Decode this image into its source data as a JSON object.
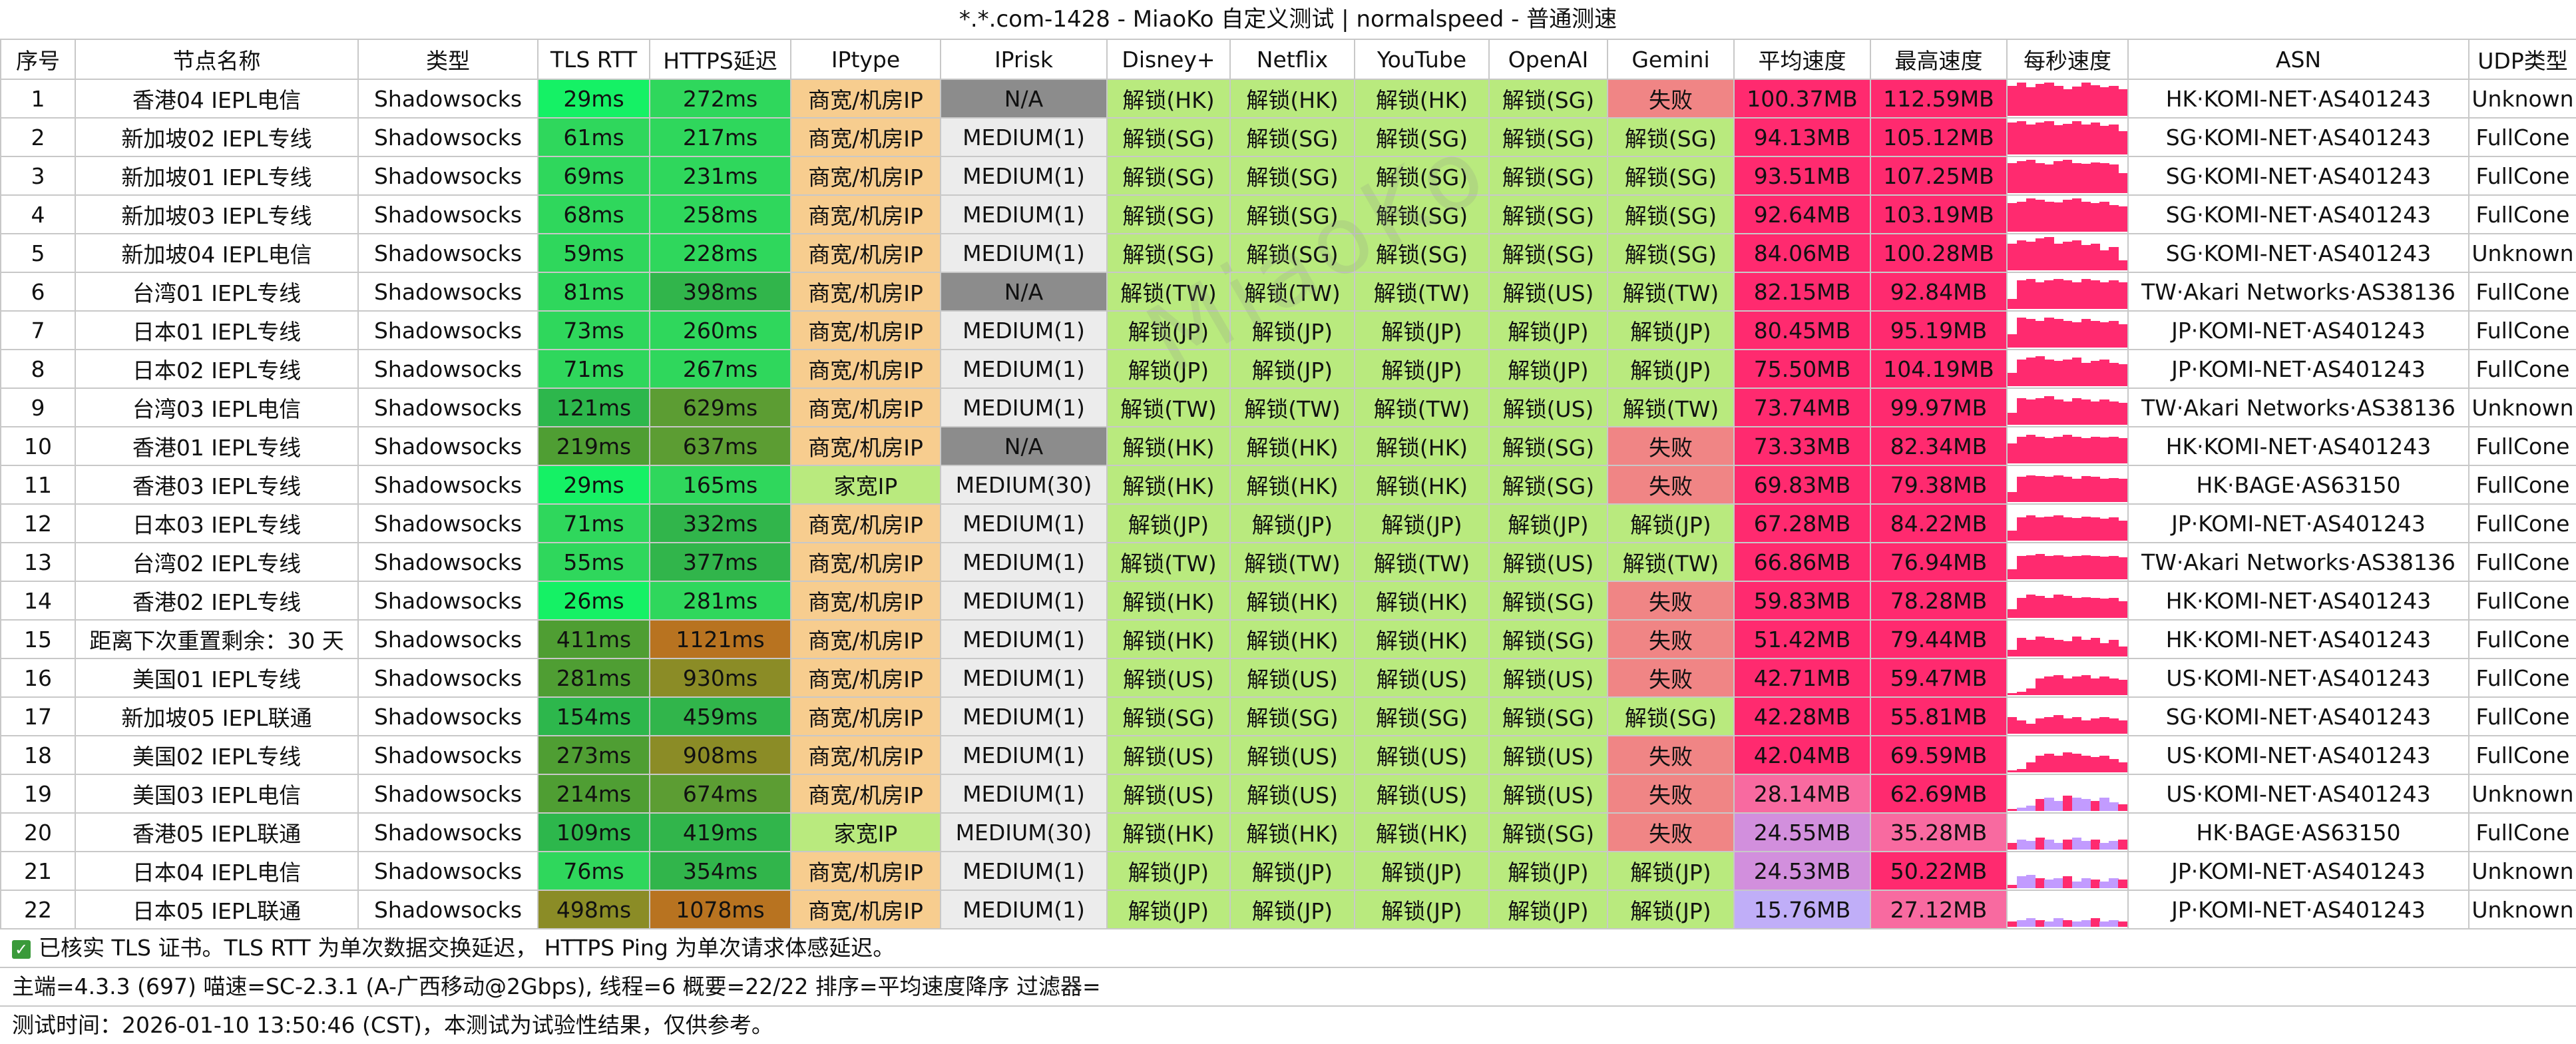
{
  "title": "*.*.com-1428 - MiaoKo 自定义测试 | normalspeed - 普通测速",
  "watermark": "MiaoKo",
  "columns": [
    "序号",
    "节点名称",
    "类型",
    "TLS RTT",
    "HTTPS延迟",
    "IPtype",
    "IPrisk",
    "Disney+",
    "Netflix",
    "YouTube",
    "OpenAI",
    "Gemini",
    "平均速度",
    "最高速度",
    "每秒速度",
    "ASN",
    "UDP类型"
  ],
  "colors": {
    "n_a": "#8c8c8c",
    "medium_bg": "#ececec",
    "unlock_bg": "#b9ea7e",
    "fail_bg": "#f08585",
    "iptype_bg": "#f7cd8f",
    "spark_pink": "#ff2a6f",
    "spark_violet": "#c29bff",
    "tls_fast": "#15f165",
    "tls_mid": "#2fd75c",
    "tls_slow": "#2db74c",
    "tls_slower": "#4f9e33",
    "tls_worst": "#8b8c26",
    "https_fast": "#2fd75c",
    "https_mid": "#31b54b",
    "https_slow": "#5c9d33",
    "https_slower": "#8b8c26",
    "https_worst": "#b87320",
    "speed_hi": "#ff2a6f",
    "speed_mid": "#f86aa0",
    "speed_low": "#d28fdd",
    "speed_lowest": "#c0aef8"
  },
  "rows": [
    {
      "idx": "1",
      "name": "香港04 IEPL电信",
      "type": "Shadowsocks",
      "tls": "29ms",
      "tls_c": "#15f165",
      "https": "272ms",
      "https_c": "#2fd75c",
      "iptype": "商宽/机房IP",
      "iptype_c": "#f7cd8f",
      "iprisk": "N/A",
      "iprisk_c": "#8c8c8c",
      "disney": "解锁(HK)",
      "netflix": "解锁(HK)",
      "youtube": "解锁(HK)",
      "openai": "解锁(SG)",
      "gemini": "失败",
      "gemini_c": "#f08585",
      "avg": "100.37MB",
      "avg_c": "#ff2a6f",
      "max": "112.59MB",
      "max_c": "#ff2a6f",
      "spark": [
        0.9,
        1,
        0.85,
        0.95,
        1,
        0.9,
        0.8,
        0.88,
        1,
        0.92,
        0.85,
        0.9,
        0.8
      ],
      "asn": "HK·KOMI-NET·AS401243",
      "udp": "Unknown"
    },
    {
      "idx": "2",
      "name": "新加坡02 IEPL专线",
      "type": "Shadowsocks",
      "tls": "61ms",
      "tls_c": "#2fd75c",
      "https": "217ms",
      "https_c": "#2fd75c",
      "iptype": "商宽/机房IP",
      "iptype_c": "#f7cd8f",
      "iprisk": "MEDIUM(1)",
      "iprisk_c": "#ececec",
      "disney": "解锁(SG)",
      "netflix": "解锁(SG)",
      "youtube": "解锁(SG)",
      "openai": "解锁(SG)",
      "gemini": "解锁(SG)",
      "gemini_c": "#b9ea7e",
      "avg": "94.13MB",
      "avg_c": "#ff2a6f",
      "max": "105.12MB",
      "max_c": "#ff2a6f",
      "spark": [
        0.95,
        1,
        0.9,
        0.95,
        1,
        0.88,
        0.92,
        1,
        0.9,
        0.95,
        0.85,
        0.9,
        0.7
      ],
      "asn": "SG·KOMI-NET·AS401243",
      "udp": "FullCone"
    },
    {
      "idx": "3",
      "name": "新加坡01 IEPL专线",
      "type": "Shadowsocks",
      "tls": "69ms",
      "tls_c": "#2fd75c",
      "https": "231ms",
      "https_c": "#2fd75c",
      "iptype": "商宽/机房IP",
      "iptype_c": "#f7cd8f",
      "iprisk": "MEDIUM(1)",
      "iprisk_c": "#ececec",
      "disney": "解锁(SG)",
      "netflix": "解锁(SG)",
      "youtube": "解锁(SG)",
      "openai": "解锁(SG)",
      "gemini": "解锁(SG)",
      "gemini_c": "#b9ea7e",
      "avg": "93.51MB",
      "avg_c": "#ff2a6f",
      "max": "107.25MB",
      "max_c": "#ff2a6f",
      "spark": [
        0.9,
        0.95,
        1,
        0.9,
        0.85,
        0.95,
        1,
        0.9,
        0.88,
        0.92,
        0.9,
        0.85,
        0.6
      ],
      "asn": "SG·KOMI-NET·AS401243",
      "udp": "FullCone"
    },
    {
      "idx": "4",
      "name": "新加坡03 IEPL专线",
      "type": "Shadowsocks",
      "tls": "68ms",
      "tls_c": "#2fd75c",
      "https": "258ms",
      "https_c": "#2fd75c",
      "iptype": "商宽/机房IP",
      "iptype_c": "#f7cd8f",
      "iprisk": "MEDIUM(1)",
      "iprisk_c": "#ececec",
      "disney": "解锁(SG)",
      "netflix": "解锁(SG)",
      "youtube": "解锁(SG)",
      "openai": "解锁(SG)",
      "gemini": "解锁(SG)",
      "gemini_c": "#b9ea7e",
      "avg": "92.64MB",
      "avg_c": "#ff2a6f",
      "max": "103.19MB",
      "max_c": "#ff2a6f",
      "spark": [
        0.85,
        0.9,
        1,
        0.95,
        0.9,
        0.88,
        0.95,
        1,
        0.9,
        0.85,
        0.9,
        0.8,
        0.75
      ],
      "asn": "SG·KOMI-NET·AS401243",
      "udp": "FullCone"
    },
    {
      "idx": "5",
      "name": "新加坡04 IEPL电信",
      "type": "Shadowsocks",
      "tls": "59ms",
      "tls_c": "#2fd75c",
      "https": "228ms",
      "https_c": "#2fd75c",
      "iptype": "商宽/机房IP",
      "iptype_c": "#f7cd8f",
      "iprisk": "MEDIUM(1)",
      "iprisk_c": "#ececec",
      "disney": "解锁(SG)",
      "netflix": "解锁(SG)",
      "youtube": "解锁(SG)",
      "openai": "解锁(SG)",
      "gemini": "解锁(SG)",
      "gemini_c": "#b9ea7e",
      "avg": "84.06MB",
      "avg_c": "#ff2a6f",
      "max": "100.28MB",
      "max_c": "#ff2a6f",
      "spark": [
        0.8,
        0.9,
        0.85,
        0.95,
        1,
        0.8,
        0.85,
        0.9,
        0.75,
        0.8,
        0.6,
        0.7,
        0.3
      ],
      "asn": "SG·KOMI-NET·AS401243",
      "udp": "Unknown"
    },
    {
      "idx": "6",
      "name": "台湾01 IEPL专线",
      "type": "Shadowsocks",
      "tls": "81ms",
      "tls_c": "#2fd75c",
      "https": "398ms",
      "https_c": "#31b54b",
      "iptype": "商宽/机房IP",
      "iptype_c": "#f7cd8f",
      "iprisk": "N/A",
      "iprisk_c": "#8c8c8c",
      "disney": "解锁(TW)",
      "netflix": "解锁(TW)",
      "youtube": "解锁(TW)",
      "openai": "解锁(US)",
      "gemini": "解锁(TW)",
      "gemini_c": "#b9ea7e",
      "avg": "82.15MB",
      "avg_c": "#ff2a6f",
      "max": "92.84MB",
      "max_c": "#ff2a6f",
      "spark": [
        0.3,
        0.85,
        0.9,
        0.8,
        0.85,
        0.9,
        0.85,
        0.8,
        0.9,
        0.85,
        0.8,
        0.85,
        0.8
      ],
      "asn": "TW·Akari Networks·AS38136",
      "udp": "FullCone"
    },
    {
      "idx": "7",
      "name": "日本01 IEPL专线",
      "type": "Shadowsocks",
      "tls": "73ms",
      "tls_c": "#2fd75c",
      "https": "260ms",
      "https_c": "#2fd75c",
      "iptype": "商宽/机房IP",
      "iptype_c": "#f7cd8f",
      "iprisk": "MEDIUM(1)",
      "iprisk_c": "#ececec",
      "disney": "解锁(JP)",
      "netflix": "解锁(JP)",
      "youtube": "解锁(JP)",
      "openai": "解锁(JP)",
      "gemini": "解锁(JP)",
      "gemini_c": "#b9ea7e",
      "avg": "80.45MB",
      "avg_c": "#ff2a6f",
      "max": "95.19MB",
      "max_c": "#ff2a6f",
      "spark": [
        0.4,
        0.9,
        0.85,
        0.8,
        0.9,
        0.85,
        0.8,
        0.75,
        0.85,
        0.8,
        0.75,
        0.8,
        0.7
      ],
      "asn": "JP·KOMI-NET·AS401243",
      "udp": "FullCone"
    },
    {
      "idx": "8",
      "name": "日本02 IEPL专线",
      "type": "Shadowsocks",
      "tls": "71ms",
      "tls_c": "#2fd75c",
      "https": "267ms",
      "https_c": "#2fd75c",
      "iptype": "商宽/机房IP",
      "iptype_c": "#f7cd8f",
      "iprisk": "MEDIUM(1)",
      "iprisk_c": "#ececec",
      "disney": "解锁(JP)",
      "netflix": "解锁(JP)",
      "youtube": "解锁(JP)",
      "openai": "解锁(JP)",
      "gemini": "解锁(JP)",
      "gemini_c": "#b9ea7e",
      "avg": "75.50MB",
      "avg_c": "#ff2a6f",
      "max": "104.19MB",
      "max_c": "#ff2a6f",
      "spark": [
        0.4,
        0.8,
        0.85,
        0.9,
        0.8,
        0.75,
        0.8,
        0.85,
        0.7,
        0.75,
        0.8,
        0.7,
        0.65
      ],
      "asn": "JP·KOMI-NET·AS401243",
      "udp": "FullCone"
    },
    {
      "idx": "9",
      "name": "台湾03 IEPL电信",
      "type": "Shadowsocks",
      "tls": "121ms",
      "tls_c": "#2db74c",
      "https": "629ms",
      "https_c": "#5c9d33",
      "iptype": "商宽/机房IP",
      "iptype_c": "#f7cd8f",
      "iprisk": "MEDIUM(1)",
      "iprisk_c": "#ececec",
      "disney": "解锁(TW)",
      "netflix": "解锁(TW)",
      "youtube": "解锁(TW)",
      "openai": "解锁(US)",
      "gemini": "解锁(TW)",
      "gemini_c": "#b9ea7e",
      "avg": "73.74MB",
      "avg_c": "#ff2a6f",
      "max": "99.97MB",
      "max_c": "#ff2a6f",
      "spark": [
        0.35,
        0.8,
        0.75,
        0.8,
        0.85,
        0.75,
        0.7,
        0.8,
        0.75,
        0.7,
        0.75,
        0.7,
        0.65
      ],
      "asn": "TW·Akari Networks·AS38136",
      "udp": "Unknown"
    },
    {
      "idx": "10",
      "name": "香港01 IEPL专线",
      "type": "Shadowsocks",
      "tls": "219ms",
      "tls_c": "#4f9e33",
      "https": "637ms",
      "https_c": "#5c9d33",
      "iptype": "商宽/机房IP",
      "iptype_c": "#f7cd8f",
      "iprisk": "N/A",
      "iprisk_c": "#8c8c8c",
      "disney": "解锁(HK)",
      "netflix": "解锁(HK)",
      "youtube": "解锁(HK)",
      "openai": "解锁(SG)",
      "gemini": "失败",
      "gemini_c": "#f08585",
      "avg": "73.33MB",
      "avg_c": "#ff2a6f",
      "max": "82.34MB",
      "max_c": "#ff2a6f",
      "spark": [
        0.6,
        0.8,
        0.85,
        0.8,
        0.75,
        0.8,
        0.85,
        0.8,
        0.75,
        0.8,
        0.78,
        0.8,
        0.75
      ],
      "asn": "HK·KOMI-NET·AS401243",
      "udp": "FullCone"
    },
    {
      "idx": "11",
      "name": "香港03 IEPL专线",
      "type": "Shadowsocks",
      "tls": "29ms",
      "tls_c": "#15f165",
      "https": "165ms",
      "https_c": "#2fd75c",
      "iptype": "家宽IP",
      "iptype_c": "#b9ea7e",
      "iprisk": "MEDIUM(30)",
      "iprisk_c": "#ececec",
      "disney": "解锁(HK)",
      "netflix": "解锁(HK)",
      "youtube": "解锁(HK)",
      "openai": "解锁(SG)",
      "gemini": "失败",
      "gemini_c": "#f08585",
      "avg": "69.83MB",
      "avg_c": "#ff2a6f",
      "max": "79.38MB",
      "max_c": "#ff2a6f",
      "spark": [
        0.3,
        0.75,
        0.8,
        0.78,
        0.75,
        0.8,
        0.75,
        0.7,
        0.78,
        0.75,
        0.7,
        0.72,
        0.7
      ],
      "asn": "HK·BAGE·AS63150",
      "udp": "FullCone"
    },
    {
      "idx": "12",
      "name": "日本03 IEPL专线",
      "type": "Shadowsocks",
      "tls": "71ms",
      "tls_c": "#2fd75c",
      "https": "332ms",
      "https_c": "#31b54b",
      "iptype": "商宽/机房IP",
      "iptype_c": "#f7cd8f",
      "iprisk": "MEDIUM(1)",
      "iprisk_c": "#ececec",
      "disney": "解锁(JP)",
      "netflix": "解锁(JP)",
      "youtube": "解锁(JP)",
      "openai": "解锁(JP)",
      "gemini": "解锁(JP)",
      "gemini_c": "#b9ea7e",
      "avg": "67.28MB",
      "avg_c": "#ff2a6f",
      "max": "84.22MB",
      "max_c": "#ff2a6f",
      "spark": [
        0.3,
        0.7,
        0.75,
        0.7,
        0.72,
        0.75,
        0.7,
        0.68,
        0.72,
        0.7,
        0.65,
        0.7,
        0.6
      ],
      "asn": "JP·KOMI-NET·AS401243",
      "udp": "FullCone"
    },
    {
      "idx": "13",
      "name": "台湾02 IEPL专线",
      "type": "Shadowsocks",
      "tls": "55ms",
      "tls_c": "#2fd75c",
      "https": "377ms",
      "https_c": "#31b54b",
      "iptype": "商宽/机房IP",
      "iptype_c": "#f7cd8f",
      "iprisk": "MEDIUM(1)",
      "iprisk_c": "#ececec",
      "disney": "解锁(TW)",
      "netflix": "解锁(TW)",
      "youtube": "解锁(TW)",
      "openai": "解锁(US)",
      "gemini": "解锁(TW)",
      "gemini_c": "#b9ea7e",
      "avg": "66.86MB",
      "avg_c": "#ff2a6f",
      "max": "76.94MB",
      "max_c": "#ff2a6f",
      "spark": [
        0.3,
        0.7,
        0.72,
        0.75,
        0.7,
        0.72,
        0.68,
        0.7,
        0.72,
        0.7,
        0.68,
        0.7,
        0.65
      ],
      "asn": "TW·Akari Networks·AS38136",
      "udp": "FullCone"
    },
    {
      "idx": "14",
      "name": "香港02 IEPL专线",
      "type": "Shadowsocks",
      "tls": "26ms",
      "tls_c": "#15f165",
      "https": "281ms",
      "https_c": "#2fd75c",
      "iptype": "商宽/机房IP",
      "iptype_c": "#f7cd8f",
      "iprisk": "MEDIUM(1)",
      "iprisk_c": "#ececec",
      "disney": "解锁(HK)",
      "netflix": "解锁(HK)",
      "youtube": "解锁(HK)",
      "openai": "解锁(SG)",
      "gemini": "失败",
      "gemini_c": "#f08585",
      "avg": "59.83MB",
      "avg_c": "#ff2a6f",
      "max": "78.28MB",
      "max_c": "#ff2a6f",
      "spark": [
        0.25,
        0.6,
        0.7,
        0.65,
        0.6,
        0.7,
        0.65,
        0.6,
        0.62,
        0.6,
        0.58,
        0.6,
        0.5
      ],
      "asn": "HK·KOMI-NET·AS401243",
      "udp": "FullCone"
    },
    {
      "idx": "15",
      "name": "距离下次重置剩余：30 天",
      "type": "Shadowsocks",
      "tls": "411ms",
      "tls_c": "#4f9e33",
      "https": "1121ms",
      "https_c": "#b87320",
      "iptype": "商宽/机房IP",
      "iptype_c": "#f7cd8f",
      "iprisk": "MEDIUM(1)",
      "iprisk_c": "#ececec",
      "disney": "解锁(HK)",
      "netflix": "解锁(HK)",
      "youtube": "解锁(HK)",
      "openai": "解锁(SG)",
      "gemini": "失败",
      "gemini_c": "#f08585",
      "avg": "51.42MB",
      "avg_c": "#ff2a6f",
      "max": "79.44MB",
      "max_c": "#ff2a6f",
      "spark": [
        0.2,
        0.55,
        0.5,
        0.6,
        0.55,
        0.5,
        0.45,
        0.6,
        0.5,
        0.55,
        0.4,
        0.5,
        0.3
      ],
      "asn": "HK·KOMI-NET·AS401243",
      "udp": "FullCone"
    },
    {
      "idx": "16",
      "name": "美国01 IEPL专线",
      "type": "Shadowsocks",
      "tls": "281ms",
      "tls_c": "#4f9e33",
      "https": "930ms",
      "https_c": "#8b8c26",
      "iptype": "商宽/机房IP",
      "iptype_c": "#f7cd8f",
      "iprisk": "MEDIUM(1)",
      "iprisk_c": "#ececec",
      "disney": "解锁(US)",
      "netflix": "解锁(US)",
      "youtube": "解锁(US)",
      "openai": "解锁(US)",
      "gemini": "失败",
      "gemini_c": "#f08585",
      "avg": "42.71MB",
      "avg_c": "#ff2a6f",
      "max": "59.47MB",
      "max_c": "#ff2a6f",
      "spark": [
        0.05,
        0.1,
        0.2,
        0.5,
        0.55,
        0.6,
        0.5,
        0.55,
        0.6,
        0.5,
        0.55,
        0.5,
        0.45
      ],
      "asn": "US·KOMI-NET·AS401243",
      "udp": "FullCone"
    },
    {
      "idx": "17",
      "name": "新加坡05 IEPL联通",
      "type": "Shadowsocks",
      "tls": "154ms",
      "tls_c": "#2db74c",
      "https": "459ms",
      "https_c": "#31b54b",
      "iptype": "商宽/机房IP",
      "iptype_c": "#f7cd8f",
      "iprisk": "MEDIUM(1)",
      "iprisk_c": "#ececec",
      "disney": "解锁(SG)",
      "netflix": "解锁(SG)",
      "youtube": "解锁(SG)",
      "openai": "解锁(SG)",
      "gemini": "解锁(SG)",
      "gemini_c": "#b9ea7e",
      "avg": "42.28MB",
      "avg_c": "#ff2a6f",
      "max": "55.81MB",
      "max_c": "#ff2a6f",
      "spark": [
        0.5,
        0.4,
        0.3,
        0.45,
        0.5,
        0.55,
        0.45,
        0.5,
        0.4,
        0.45,
        0.5,
        0.45,
        0.4
      ],
      "asn": "SG·KOMI-NET·AS401243",
      "udp": "FullCone"
    },
    {
      "idx": "18",
      "name": "美国02 IEPL专线",
      "type": "Shadowsocks",
      "tls": "273ms",
      "tls_c": "#4f9e33",
      "https": "908ms",
      "https_c": "#8b8c26",
      "iptype": "商宽/机房IP",
      "iptype_c": "#f7cd8f",
      "iprisk": "MEDIUM(1)",
      "iprisk_c": "#ececec",
      "disney": "解锁(US)",
      "netflix": "解锁(US)",
      "youtube": "解锁(US)",
      "openai": "解锁(US)",
      "gemini": "失败",
      "gemini_c": "#f08585",
      "avg": "42.04MB",
      "avg_c": "#ff2a6f",
      "max": "69.59MB",
      "max_c": "#ff2a6f",
      "spark": [
        0.05,
        0.1,
        0.3,
        0.5,
        0.55,
        0.5,
        0.6,
        0.55,
        0.5,
        0.45,
        0.5,
        0.4,
        0.3
      ],
      "asn": "US·KOMI-NET·AS401243",
      "udp": "FullCone"
    },
    {
      "idx": "19",
      "name": "美国03 IEPL电信",
      "type": "Shadowsocks",
      "tls": "214ms",
      "tls_c": "#4f9e33",
      "https": "674ms",
      "https_c": "#5c9d33",
      "iptype": "商宽/机房IP",
      "iptype_c": "#f7cd8f",
      "iprisk": "MEDIUM(1)",
      "iprisk_c": "#ececec",
      "disney": "解锁(US)",
      "netflix": "解锁(US)",
      "youtube": "解锁(US)",
      "openai": "解锁(US)",
      "gemini": "失败",
      "gemini_c": "#f08585",
      "avg": "28.14MB",
      "avg_c": "#f86aa0",
      "max": "62.69MB",
      "max_c": "#ff2a6f",
      "spark": [
        0.05,
        0.1,
        0.15,
        0.35,
        0.4,
        0.3,
        0.45,
        0.4,
        0.35,
        0.3,
        0.4,
        0.25,
        0.2
      ],
      "asn": "US·KOMI-NET·AS401243",
      "udp": "Unknown"
    },
    {
      "idx": "20",
      "name": "香港05 IEPL联通",
      "type": "Shadowsocks",
      "tls": "109ms",
      "tls_c": "#2db74c",
      "https": "419ms",
      "https_c": "#31b54b",
      "iptype": "家宽IP",
      "iptype_c": "#b9ea7e",
      "iprisk": "MEDIUM(30)",
      "iprisk_c": "#ececec",
      "disney": "解锁(HK)",
      "netflix": "解锁(HK)",
      "youtube": "解锁(HK)",
      "openai": "解锁(SG)",
      "gemini": "失败",
      "gemini_c": "#f08585",
      "avg": "24.55MB",
      "avg_c": "#d28fdd",
      "max": "35.28MB",
      "max_c": "#f86aa0",
      "spark": [
        0.2,
        0.3,
        0.25,
        0.35,
        0.3,
        0.2,
        0.3,
        0.35,
        0.25,
        0.3,
        0.2,
        0.25,
        0.3
      ],
      "asn": "HK·BAGE·AS63150",
      "udp": "FullCone"
    },
    {
      "idx": "21",
      "name": "日本04 IEPL电信",
      "type": "Shadowsocks",
      "tls": "76ms",
      "tls_c": "#2fd75c",
      "https": "354ms",
      "https_c": "#31b54b",
      "iptype": "商宽/机房IP",
      "iptype_c": "#f7cd8f",
      "iprisk": "MEDIUM(1)",
      "iprisk_c": "#ececec",
      "disney": "解锁(JP)",
      "netflix": "解锁(JP)",
      "youtube": "解锁(JP)",
      "openai": "解锁(JP)",
      "gemini": "解锁(JP)",
      "gemini_c": "#b9ea7e",
      "avg": "24.53MB",
      "avg_c": "#d28fdd",
      "max": "50.22MB",
      "max_c": "#ff2a6f",
      "spark": [
        0.1,
        0.35,
        0.4,
        0.3,
        0.25,
        0.3,
        0.35,
        0.2,
        0.3,
        0.25,
        0.2,
        0.3,
        0.25
      ],
      "asn": "JP·KOMI-NET·AS401243",
      "udp": "Unknown"
    },
    {
      "idx": "22",
      "name": "日本05 IEPL联通",
      "type": "Shadowsocks",
      "tls": "498ms",
      "tls_c": "#8b8c26",
      "https": "1078ms",
      "https_c": "#b87320",
      "iptype": "商宽/机房IP",
      "iptype_c": "#f7cd8f",
      "iprisk": "MEDIUM(1)",
      "iprisk_c": "#ececec",
      "disney": "解锁(JP)",
      "netflix": "解锁(JP)",
      "youtube": "解锁(JP)",
      "openai": "解锁(JP)",
      "gemini": "解锁(JP)",
      "gemini_c": "#b9ea7e",
      "avg": "15.76MB",
      "avg_c": "#c0aef8",
      "max": "27.12MB",
      "max_c": "#f86aa0",
      "spark": [
        0.15,
        0.2,
        0.25,
        0.2,
        0.15,
        0.25,
        0.2,
        0.15,
        0.2,
        0.25,
        0.15,
        0.2,
        0.15
      ],
      "asn": "JP·KOMI-NET·AS401243",
      "udp": "Unknown"
    }
  ],
  "footer": {
    "line1": "已核实 TLS 证书。TLS RTT 为单次数据交换延迟， HTTPS Ping 为单次请求体感延迟。",
    "line1_check": "✓",
    "line2": "主端=4.3.3 (697) 喵速=SC-2.3.1 (A-广西移动@2Gbps), 线程=6 概要=22/22 排序=平均速度降序 过滤器=",
    "line3": "测试时间：2026-01-10 13:50:46 (CST)，本测试为试验性结果，仅供参考。"
  }
}
